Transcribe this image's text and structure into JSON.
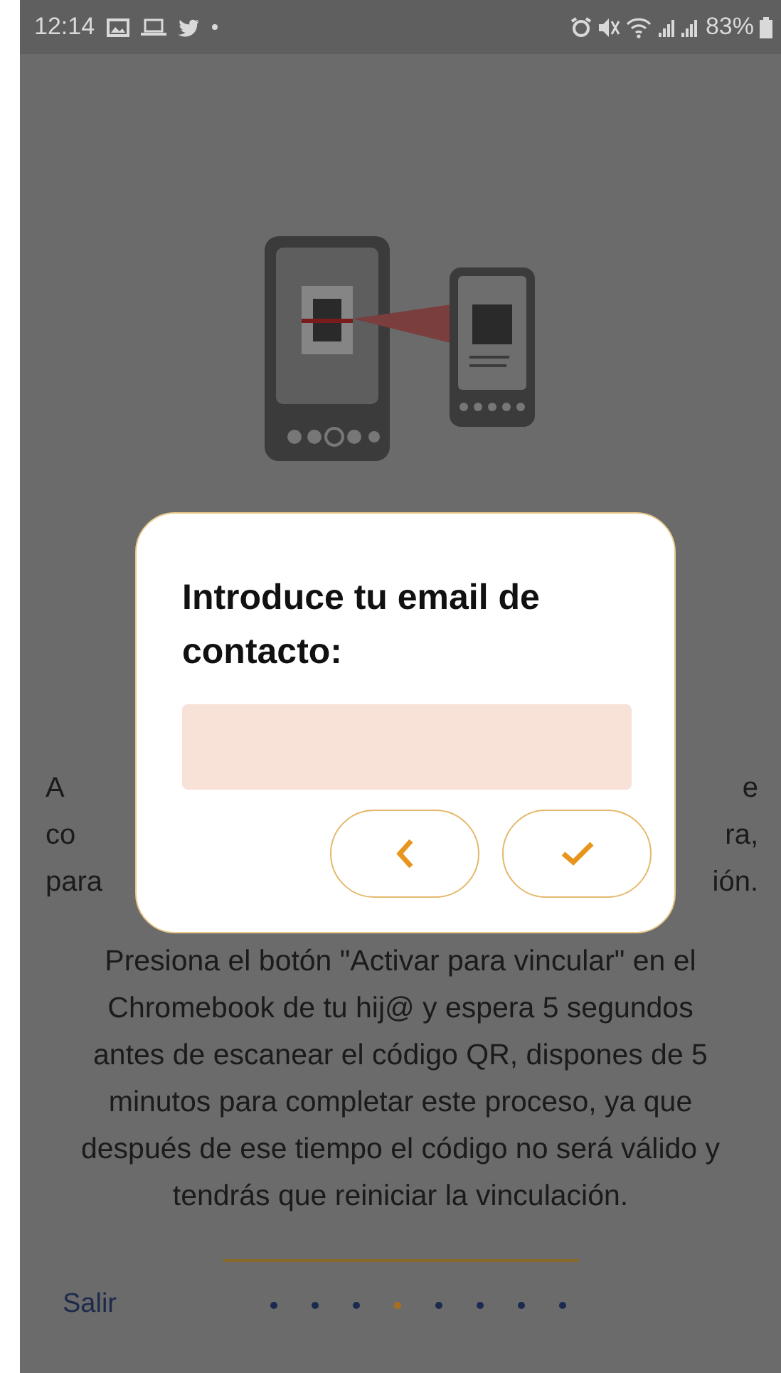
{
  "status_bar": {
    "time": "12:14",
    "battery": "83%"
  },
  "intro_fragments": [
    {
      "left": "A",
      "right": "e"
    },
    {
      "left": "co",
      "right": "ra,"
    },
    {
      "left": "para",
      "right": "ión."
    }
  ],
  "instructions": "Presiona el botón \"Activar para vincular\" en el Chromebook de tu hij@ y espera 5 segundos antes de escanear el código QR, dispones de 5 minutos para completar este proceso, ya que después de ese tiempo el código no será válido y tendrás que reiniciar la vinculación.",
  "footer": {
    "exit_label": "Salir",
    "pages": [
      {
        "selected": false
      },
      {
        "selected": false
      },
      {
        "selected": false
      },
      {
        "selected": true
      },
      {
        "selected": false
      },
      {
        "selected": false
      },
      {
        "selected": false
      },
      {
        "selected": false
      }
    ]
  },
  "dialog": {
    "title": "Introduce tu email de contacto:",
    "buttons": [
      {
        "kind": "back"
      },
      {
        "kind": "confirm"
      }
    ]
  }
}
